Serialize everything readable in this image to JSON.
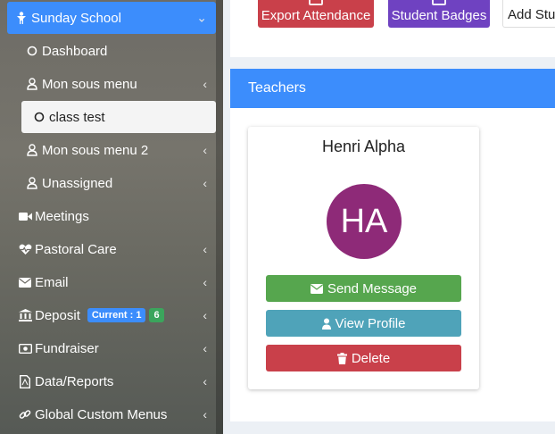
{
  "sidebar": {
    "items": [
      {
        "label": "Sunday School",
        "icon": "child-icon"
      },
      {
        "label": "Dashboard",
        "icon": "circle-icon"
      },
      {
        "label": "Mon sous menu",
        "icon": "user-icon",
        "chevron": "‹"
      },
      {
        "label": "class test",
        "icon": "circle-icon"
      },
      {
        "label": "Mon sous menu 2",
        "icon": "user-icon",
        "chevron": "‹"
      },
      {
        "label": "Unassigned",
        "icon": "user-icon",
        "chevron": "‹"
      },
      {
        "label": "Meetings",
        "icon": "video-icon"
      },
      {
        "label": "Pastoral Care",
        "icon": "heartbeat-icon",
        "chevron": "‹"
      },
      {
        "label": "Email",
        "icon": "envelope-icon",
        "chevron": "‹"
      },
      {
        "label": "Deposit",
        "icon": "bank-icon",
        "chevron": "‹",
        "badge_current": "Current : 1",
        "badge_count": "6"
      },
      {
        "label": "Fundraiser",
        "icon": "money-icon",
        "chevron": "‹"
      },
      {
        "label": "Data/Reports",
        "icon": "file-pdf-icon",
        "chevron": "‹"
      },
      {
        "label": "Global Custom Menus",
        "icon": "link-icon",
        "chevron": "‹"
      }
    ],
    "active_chevron": "⌄"
  },
  "toolbar": {
    "export_attendance": "Export Attendance",
    "student_badges": "Student Badges",
    "add_student": "Add Stude"
  },
  "teachers": {
    "header": "Teachers",
    "card": {
      "name": "Henri Alpha",
      "initials": "HA",
      "send_message": "Send Message",
      "view_profile": "View Profile",
      "delete": "Delete"
    }
  },
  "colors": {
    "primary": "#3c8dfc",
    "danger": "#c9404a",
    "purple": "#6f42c1",
    "success": "#56a64e",
    "info": "#4fa3b9",
    "avatar": "#8e2a78"
  }
}
